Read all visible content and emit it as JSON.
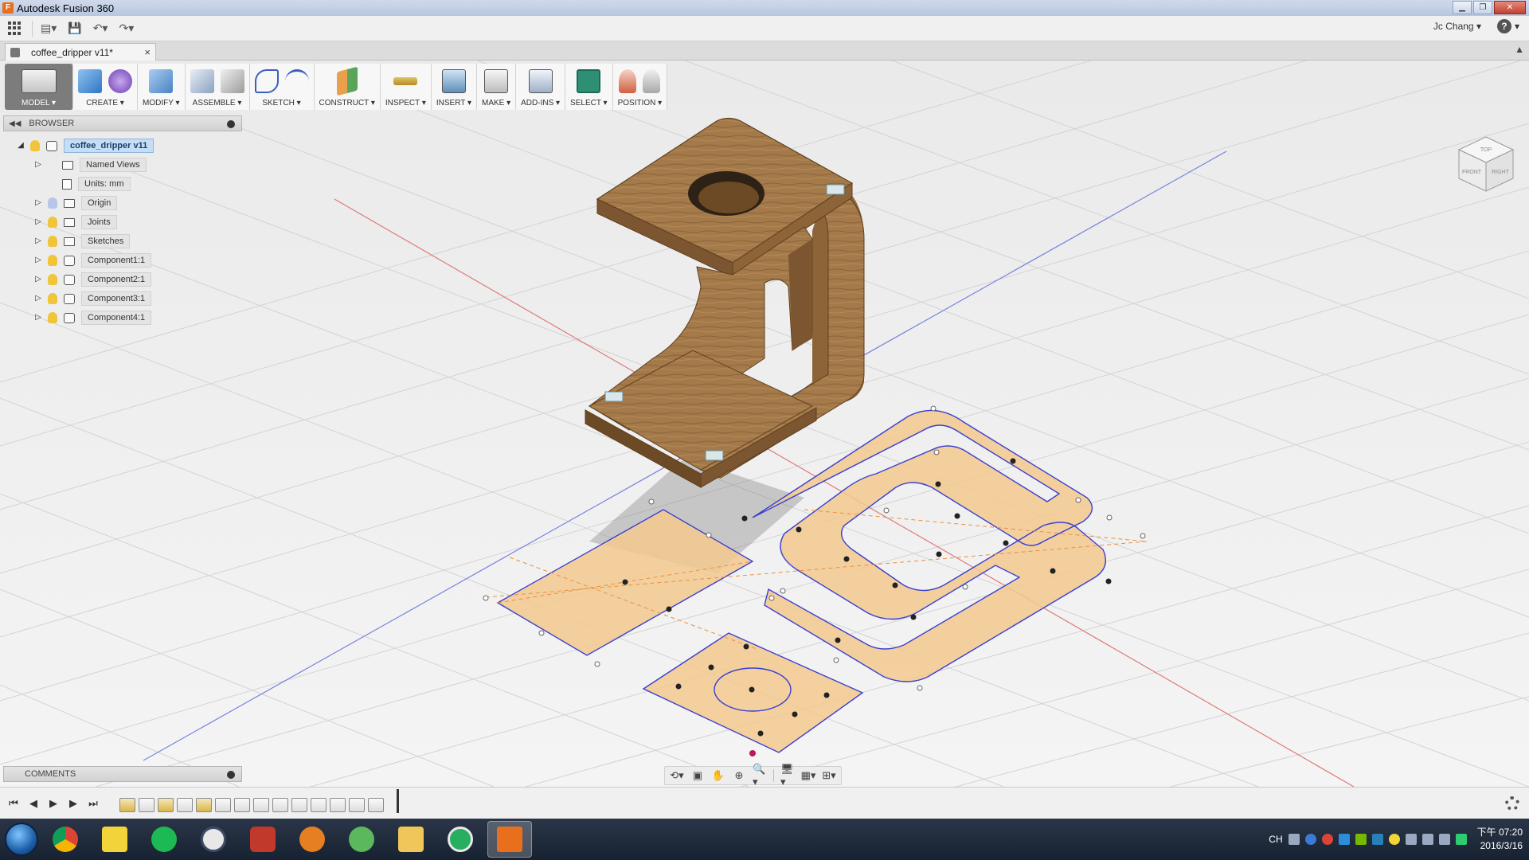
{
  "window": {
    "title": "Autodesk Fusion 360"
  },
  "quick_access": {
    "user": "Jc Chang",
    "help": "?"
  },
  "document_tab": {
    "label": "coffee_dripper v11*",
    "close": "×"
  },
  "toolbar": {
    "groups": [
      {
        "label": "MODEL ▾"
      },
      {
        "label": "CREATE ▾"
      },
      {
        "label": "MODIFY ▾"
      },
      {
        "label": "ASSEMBLE ▾"
      },
      {
        "label": "SKETCH ▾"
      },
      {
        "label": "CONSTRUCT ▾"
      },
      {
        "label": "INSPECT ▾"
      },
      {
        "label": "INSERT ▾"
      },
      {
        "label": "MAKE ▾"
      },
      {
        "label": "ADD-INS ▾"
      },
      {
        "label": "SELECT ▾"
      },
      {
        "label": "POSITION ▾"
      }
    ]
  },
  "browser": {
    "title": "BROWSER",
    "root": "coffee_dripper v11",
    "items": [
      {
        "label": "Named Views"
      },
      {
        "label": "Units: mm"
      },
      {
        "label": "Origin"
      },
      {
        "label": "Joints"
      },
      {
        "label": "Sketches"
      },
      {
        "label": "Component1:1"
      },
      {
        "label": "Component2:1"
      },
      {
        "label": "Component3:1"
      },
      {
        "label": "Component4:1"
      }
    ]
  },
  "comments": {
    "title": "COMMENTS"
  },
  "viewcube": {
    "top": "TOP",
    "front": "FRONT",
    "right": "RIGHT"
  },
  "taskbar": {
    "tray_text": "CH",
    "time": "下午 07:20",
    "date": "2016/3/16"
  },
  "colors": {
    "accent_select": "#2f8f74",
    "sketch_fill": "#f3c98f",
    "sketch_line": "#3a3fd1",
    "wood": "#a57a4c"
  }
}
